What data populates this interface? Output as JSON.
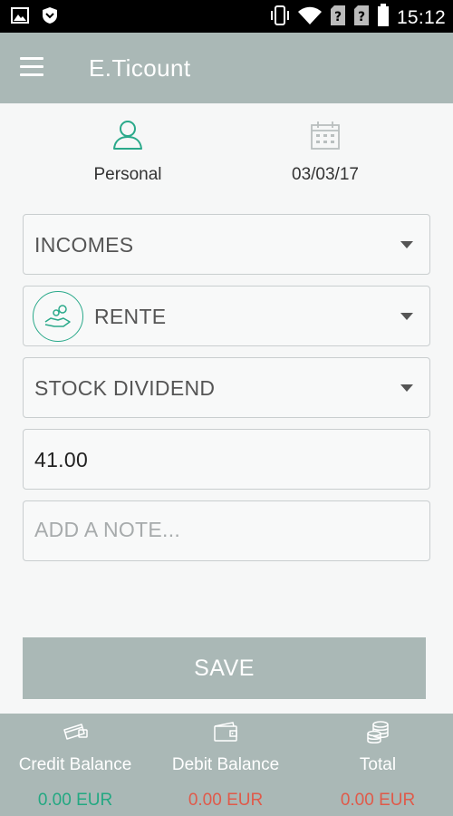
{
  "status_bar": {
    "time": "15:12"
  },
  "app": {
    "title": "E.Ticount"
  },
  "top_row": {
    "account_label": "Personal",
    "date": "03/03/17"
  },
  "form": {
    "type_select": "INCOMES",
    "category_select": "RENTE",
    "subcategory_select": "STOCK DIVIDEND",
    "amount_value": "41.00",
    "note_placeholder": "ADD A NOTE..."
  },
  "save_label": "SAVE",
  "bottom_bar": {
    "credit": {
      "label": "Credit Balance",
      "amount": "0.00 EUR",
      "color": "#23a882"
    },
    "debit": {
      "label": "Debit Balance",
      "amount": "0.00 EUR",
      "color": "#e05a4a"
    },
    "total": {
      "label": "Total",
      "amount": "0.00 EUR",
      "color": "#e05a4a"
    }
  },
  "colors": {
    "accent": "#2aa98a",
    "bar": "#aab8b6",
    "negative": "#e05a4a",
    "positive": "#23a882"
  },
  "icons": [
    "image-icon",
    "shield-icon",
    "vibrate-icon",
    "wifi-icon",
    "sim-unknown-icon",
    "battery-icon",
    "menu-icon",
    "person-icon",
    "calendar-icon",
    "chevron-down-icon",
    "hand-coins-icon",
    "credit-card-icon",
    "wallet-icon",
    "coins-stack-icon"
  ]
}
